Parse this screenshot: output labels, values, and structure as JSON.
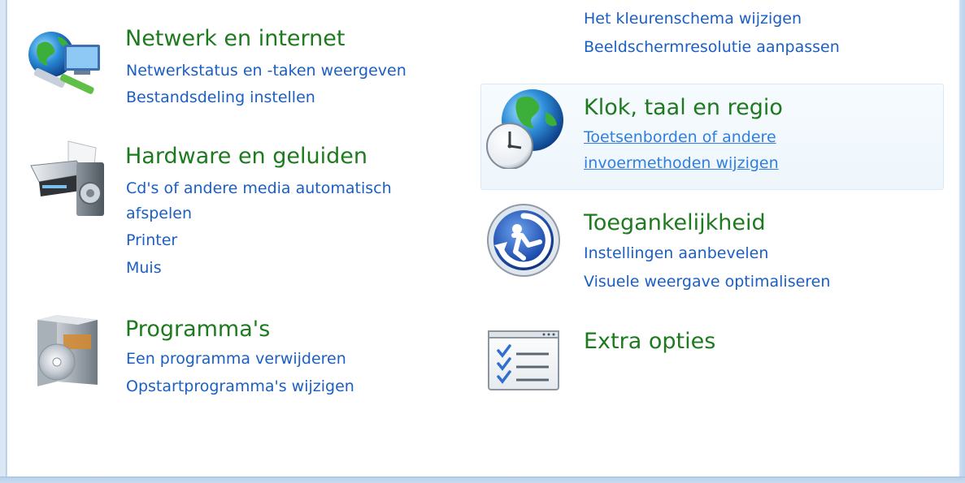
{
  "left_column": {
    "network": {
      "icon": "network-globe-icon",
      "title": "Netwerk en internet",
      "links": [
        "Netwerkstatus en -taken weergeven",
        "Bestandsdeling instellen"
      ]
    },
    "hardware": {
      "icon": "printer-speaker-icon",
      "title": "Hardware en geluiden",
      "links": [
        "Cd's of andere media automatisch",
        "afspelen",
        "Printer",
        "Muis"
      ]
    },
    "programs": {
      "icon": "software-box-icon",
      "title": "Programma's",
      "links": [
        "Een programma verwijderen",
        "Opstartprogramma's wijzigen"
      ]
    }
  },
  "right_column": {
    "appearance": {
      "links": [
        "Het kleurenschema wijzigen",
        "Beeldschermresolutie aanpassen"
      ]
    },
    "clock": {
      "icon": "clock-globe-icon",
      "title": "Klok, taal en regio",
      "links": [
        "Toetsenborden of andere ",
        "invoermethoden wijzigen"
      ]
    },
    "accessibility": {
      "icon": "ease-of-access-icon",
      "title": "Toegankelijkheid",
      "links": [
        "Instellingen aanbevelen",
        "Visuele weergave optimaliseren"
      ]
    },
    "extra": {
      "icon": "checklist-icon",
      "title": "Extra opties"
    }
  },
  "colors": {
    "title_green": "#1e7a1e",
    "link_blue": "#1b5fc4",
    "hover_bg": "#eef6fc"
  }
}
